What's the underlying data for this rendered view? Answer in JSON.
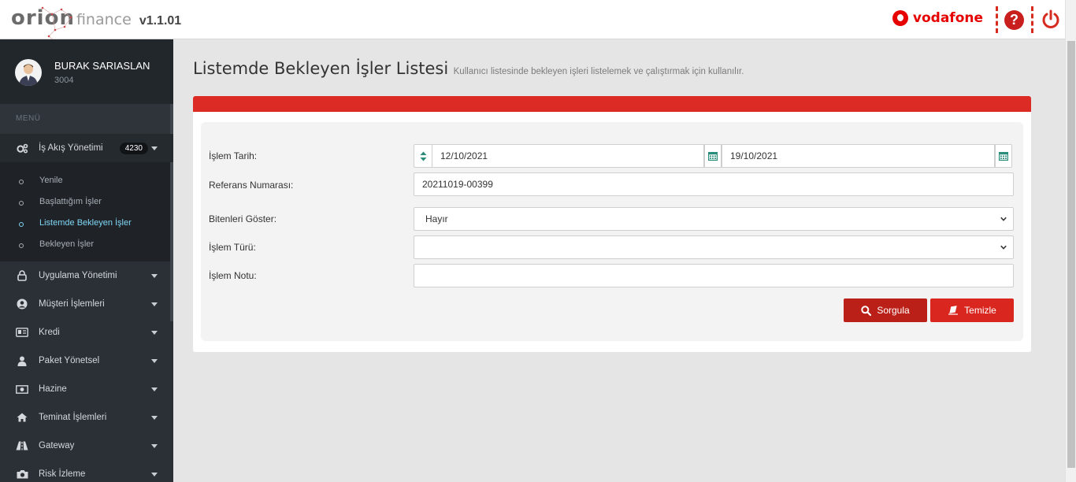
{
  "header": {
    "logo_main": "orion",
    "logo_sub": "finance",
    "version": "v1.1.01",
    "brand": "vodafone",
    "help_icon": "question-circle-icon",
    "power_icon": "power-icon",
    "accent": "#d62b1f"
  },
  "user": {
    "name": "BURAK SARIASLAN",
    "id": "3004"
  },
  "sidebar": {
    "menu_title": "MENÜ",
    "items": [
      {
        "label": "İş Akış Yönetimi",
        "icon": "gears-icon",
        "badge": "4230",
        "expanded": true
      },
      {
        "label": "Uygulama Yönetimi",
        "icon": "lock-icon"
      },
      {
        "label": "Müşteri İşlemleri",
        "icon": "user-circle-icon"
      },
      {
        "label": "Kredi",
        "icon": "id-card-icon"
      },
      {
        "label": "Paket Yönetsel",
        "icon": "user-icon"
      },
      {
        "label": "Hazine",
        "icon": "money-icon"
      },
      {
        "label": "Teminat İşlemleri",
        "icon": "home-icon"
      },
      {
        "label": "Gateway",
        "icon": "road-icon"
      },
      {
        "label": "Risk İzleme",
        "icon": "camera-icon"
      }
    ],
    "submenu": [
      {
        "label": "Yenile"
      },
      {
        "label": "Başlattığım İşler"
      },
      {
        "label": "Listemde Bekleyen İşler",
        "current": true
      },
      {
        "label": "Bekleyen İşler"
      }
    ]
  },
  "page": {
    "title": "Listemde Bekleyen İşler Listesi",
    "description": "Kullanıcı listesinde bekleyen işleri listelemek ve çalıştırmak için kullanılır."
  },
  "form": {
    "date_label": "İşlem Tarih:",
    "date_from": "12/10/2021",
    "date_to": "19/10/2021",
    "ref_label": "Referans Numarası:",
    "ref_value": "20211019-00399",
    "show_done_label": "Bitenleri Göster:",
    "show_done_value": "Hayır",
    "type_label": "İşlem Türü:",
    "type_value": "",
    "note_label": "İşlem Notu:",
    "note_value": "",
    "query_button": "Sorgula",
    "clear_button": "Temizle"
  }
}
